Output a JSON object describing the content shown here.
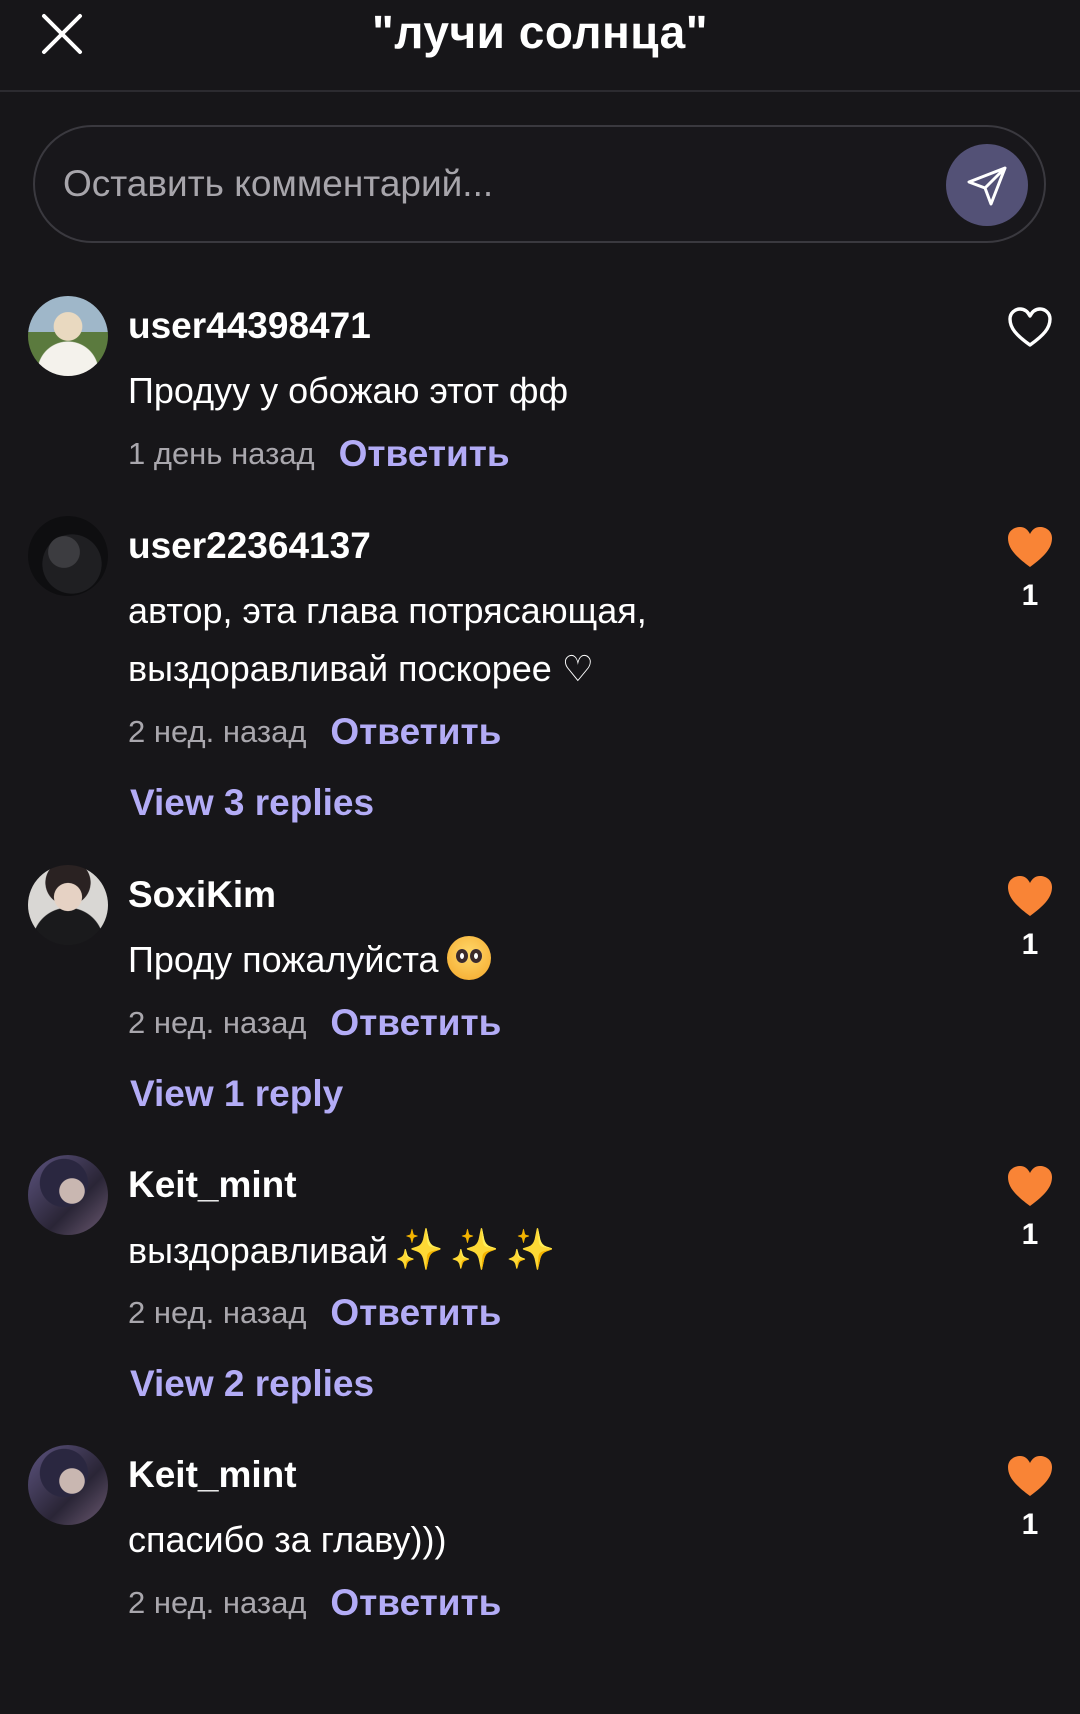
{
  "header": {
    "title": "\"лучи солнца\""
  },
  "comment_input": {
    "placeholder": "Оставить комментарий..."
  },
  "comments": [
    {
      "username": "user44398471",
      "text": "Продуу у обожаю этот фф",
      "time": "1 день назад",
      "reply_label": "Ответить",
      "liked": false,
      "like_count": ""
    },
    {
      "username": "user22364137",
      "text_line1": "автор, эта глава потрясающая,",
      "text_line2": "выздоравливай поскорее ♡",
      "time": "2 нед. назад",
      "reply_label": "Ответить",
      "view_replies": "View 3 replies",
      "liked": true,
      "like_count": "1"
    },
    {
      "username": "SoxiKim",
      "text": "Проду пожалуйста",
      "emoji": "pleading-face",
      "time": "2 нед. назад",
      "reply_label": "Ответить",
      "view_replies": "View 1 reply",
      "liked": true,
      "like_count": "1"
    },
    {
      "username": "Keit_mint",
      "text": "выздоравливай",
      "emoji": "sparkles x3",
      "time": "2 нед. назад",
      "reply_label": "Ответить",
      "view_replies": "View 2 replies",
      "liked": true,
      "like_count": "1"
    },
    {
      "username": "Keit_mint",
      "text": "спасибо за главу)))",
      "time": "2 нед. назад",
      "reply_label": "Ответить",
      "liked": true,
      "like_count": "1"
    }
  ],
  "colors": {
    "background": "#171619",
    "accent_link": "#b3acf6",
    "like_active": "#f98436",
    "send_button": "#535176"
  },
  "icons": {
    "close": "close-icon",
    "send": "send-icon",
    "like_empty": "heart-outline-icon",
    "like_filled": "heart-filled-icon"
  }
}
